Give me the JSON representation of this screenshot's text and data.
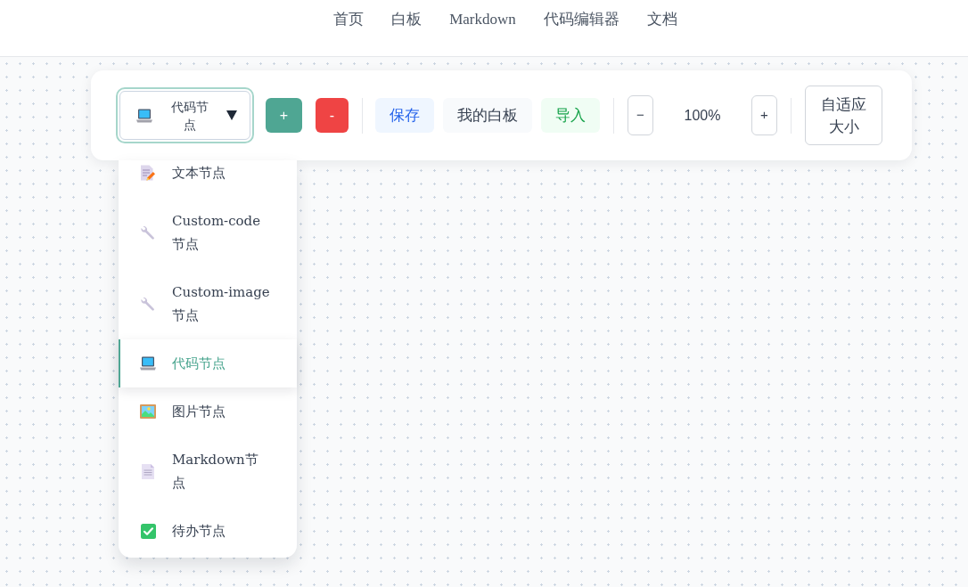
{
  "nav_links": [
    "首页",
    "白板",
    "Markdown",
    "代码编辑器",
    "文档"
  ],
  "toolbar": {
    "node_select": {
      "value": "代码节点",
      "kind": "code",
      "expanded": true
    },
    "add_button": "+",
    "remove_button": "-",
    "actions": [
      {
        "label": "保存",
        "kind": "save"
      },
      {
        "label": "我的白板",
        "kind": "boards"
      },
      {
        "label": "导入",
        "kind": "import"
      }
    ],
    "zoom": {
      "out_button": "−",
      "value": "100%",
      "in_button": "+"
    },
    "fit_button": "自适应大小"
  },
  "node_menu": {
    "items": [
      {
        "label": "文本节点",
        "kind": "text",
        "selected": false
      },
      {
        "label": "Custom-code节点",
        "kind": "custom",
        "selected": false
      },
      {
        "label": "Custom-image节点",
        "kind": "custom",
        "selected": false
      },
      {
        "label": "代码节点",
        "kind": "code",
        "selected": true
      },
      {
        "label": "图片节点",
        "kind": "image",
        "selected": false
      },
      {
        "label": "Markdown节点",
        "kind": "markdown",
        "selected": false
      },
      {
        "label": "待办节点",
        "kind": "todo",
        "selected": false
      }
    ]
  }
}
